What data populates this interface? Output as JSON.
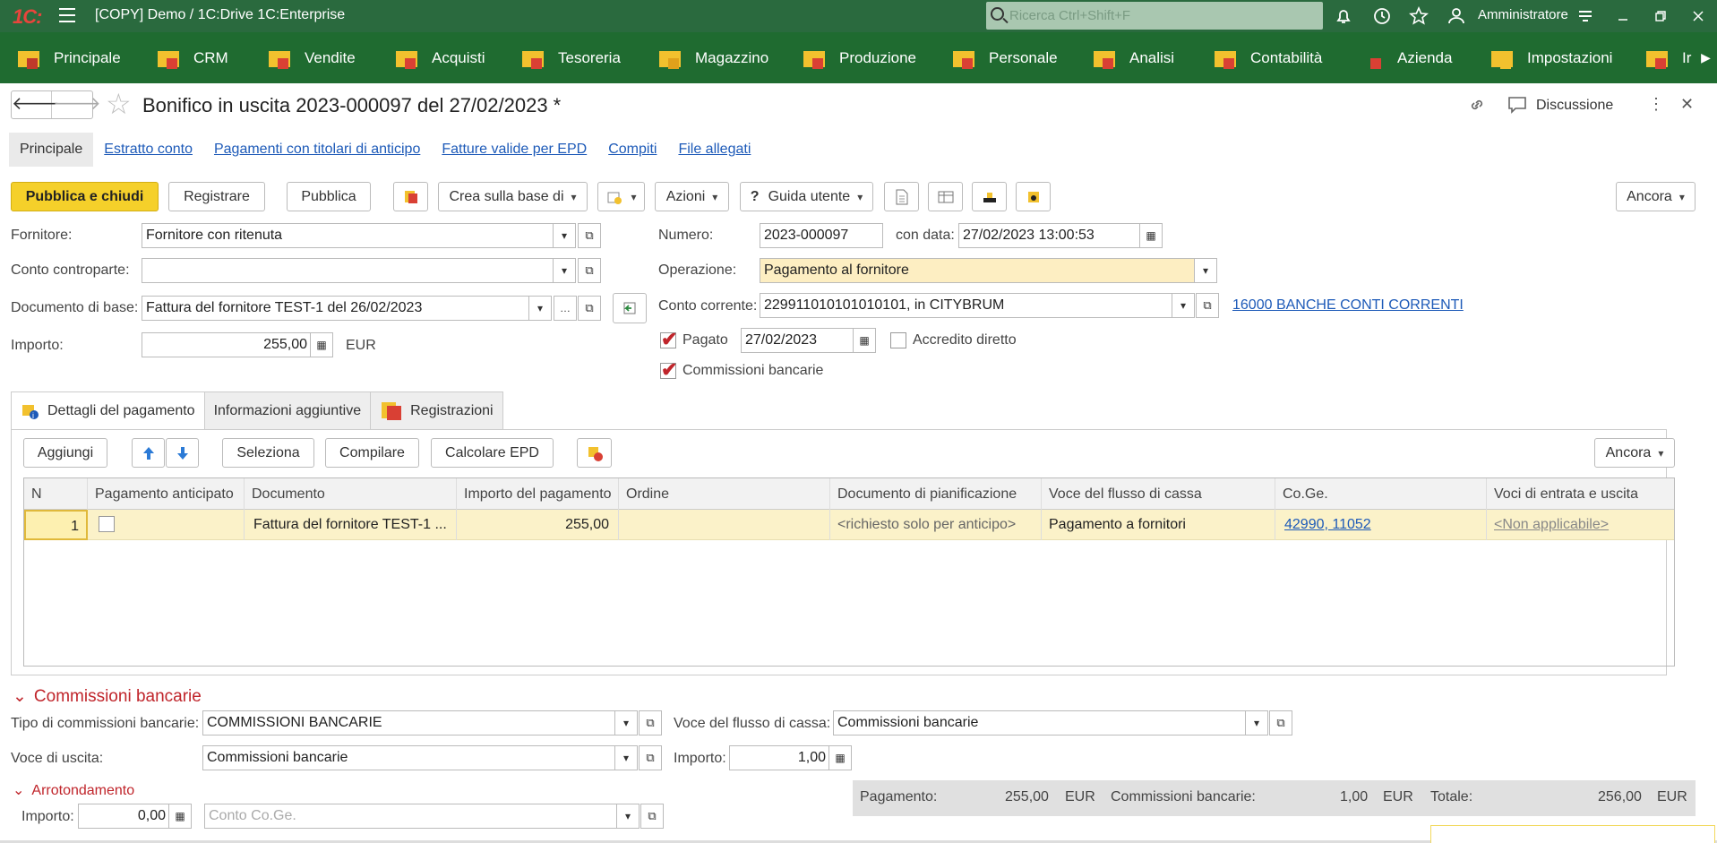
{
  "app": {
    "logo": "1С:",
    "window_title": "[COPY] Demo / 1C:Drive 1C:Enterprise",
    "search_placeholder": "Ricerca Ctrl+Shift+F",
    "user": "Amministratore"
  },
  "sections": [
    {
      "label": "Principale"
    },
    {
      "label": "CRM"
    },
    {
      "label": "Vendite"
    },
    {
      "label": "Acquisti"
    },
    {
      "label": "Tesoreria"
    },
    {
      "label": "Magazzino"
    },
    {
      "label": "Produzione"
    },
    {
      "label": "Personale"
    },
    {
      "label": "Analisi"
    },
    {
      "label": "Contabilità"
    },
    {
      "label": "Azienda"
    },
    {
      "label": "Impostazioni"
    },
    {
      "label": "Ir"
    }
  ],
  "document": {
    "title": "Bonifico in uscita 2023-000097 del 27/02/2023 *",
    "discussion_label": "Discussione"
  },
  "tabs": [
    "Principale",
    "Estratto conto",
    "Pagamenti con titolari di anticipo",
    "Fatture valide per EPD",
    "Compiti",
    "File allegati"
  ],
  "toolbar": {
    "post_close": "Pubblica e chiudi",
    "register": "Registrare",
    "post": "Pubblica",
    "create_based": "Crea sulla base di",
    "actions": "Azioni",
    "help": "Guida utente",
    "help_glyph": "?",
    "more": "Ancora"
  },
  "form": {
    "supplier_label": "Fornitore:",
    "supplier_value": "Fornitore con ritenuta",
    "counterparty_account_label": "Conto controparte:",
    "counterparty_account_value": "",
    "base_doc_label": "Documento di base:",
    "base_doc_value": "Fattura del fornitore TEST-1 del 26/02/2023",
    "amount_label": "Importo:",
    "amount_value": "255,00",
    "currency": "EUR",
    "number_label": "Numero:",
    "number_value": "2023-000097",
    "date_label": "con data:",
    "date_value": "27/02/2023 13:00:53",
    "operation_label": "Operazione:",
    "operation_value": "Pagamento al fornitore",
    "bank_account_label": "Conto corrente:",
    "bank_account_value": "229911010101010101, in CITYBRUM",
    "bank_account_link": "16000 BANCHE CONTI CORRENTI",
    "paid_label": "Pagato",
    "paid_checked": true,
    "paid_date": "27/02/2023",
    "direct_credit_label": "Accredito diretto",
    "direct_credit_checked": false,
    "bank_fees_label": "Commissioni bancarie",
    "bank_fees_checked": true
  },
  "page_tabs": [
    "Dettagli del pagamento",
    "Informazioni aggiuntive",
    "Registrazioni"
  ],
  "grid_toolbar": {
    "add": "Aggiungi",
    "select": "Seleziona",
    "fill": "Compilare",
    "calc_epd": "Calcolare EPD",
    "more": "Ancora"
  },
  "grid": {
    "columns": [
      "N",
      "Pagamento anticipato",
      "Documento",
      "Importo del pagamento",
      "Ordine",
      "Documento di pianificazione",
      "Voce del flusso di cassa",
      "Co.Ge.",
      "Voci di entrata e uscita"
    ],
    "rows": [
      {
        "n": "1",
        "advance": false,
        "document": "Fattura del fornitore TEST-1 ...",
        "amount": "255,00",
        "order": "",
        "planning_doc": "<richiesto solo per anticipo>",
        "cash_flow_item": "Pagamento a fornitori",
        "gl": "42990, 11052",
        "income_expense": "<Non applicabile>"
      }
    ]
  },
  "bank_fees": {
    "heading": "Commissioni bancarie",
    "type_label": "Tipo di commissioni bancarie:",
    "type_value": "COMMISSIONI BANCARIE",
    "cash_flow_label": "Voce del flusso di cassa:",
    "cash_flow_value": "Commissioni bancarie",
    "expense_item_label": "Voce di uscita:",
    "expense_item_value": "Commissioni bancarie",
    "amount_label": "Importo:",
    "amount_value": "1,00"
  },
  "rounding": {
    "heading": "Arrotondamento",
    "amount_label": "Importo:",
    "amount_value": "0,00",
    "gl_placeholder": "Conto Co.Ge."
  },
  "totals": {
    "payment_label": "Pagamento:",
    "payment_value": "255,00",
    "payment_currency": "EUR",
    "fees_label": "Commissioni bancarie:",
    "fees_value": "1,00",
    "fees_currency": "EUR",
    "total_label": "Totale:",
    "total_value": "256,00",
    "total_currency": "EUR"
  }
}
